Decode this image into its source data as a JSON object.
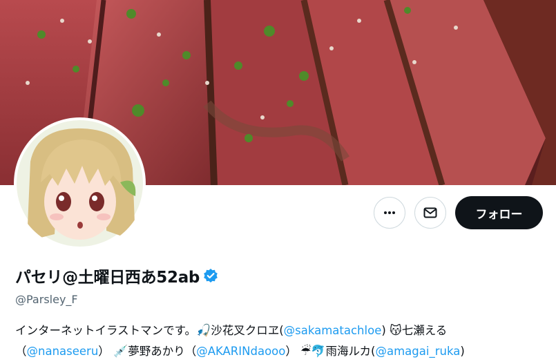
{
  "profile": {
    "display_name": "パセリ@土曜日西あ52ab",
    "handle": "@Parsley_F",
    "follow_label": "フォロー",
    "bio": {
      "line1_text": "インターネットイラストマンです。",
      "line1_name1": "沙花叉クロヱ(",
      "line1_link1": "@sakamatachloe",
      "line1_close1": ")",
      "line1_name2": "七瀬える",
      "line2_open1": "（",
      "line2_link1": "@nanaseeru",
      "line2_close1": "）",
      "line2_name1": "夢野あかり（",
      "line2_link2": "@AKARINdaooo",
      "line2_close2": "）",
      "line2_name2": "雨海ルカ(",
      "line2_link3": "@amagai_ruka",
      "line2_close3": ")",
      "emoji": {
        "fishing": "🎣",
        "cat_kiss": "😽",
        "syringe": "💉",
        "umbrella": "☔",
        "dolphin": "🐬"
      }
    }
  },
  "colors": {
    "link": "#1d9bf0",
    "verified": "#1d9bf0",
    "follow_bg": "#0f1419",
    "border": "#cfd9de",
    "muted": "#536471"
  },
  "icons": [
    "more-icon",
    "mail-icon",
    "verified-badge-icon"
  ]
}
